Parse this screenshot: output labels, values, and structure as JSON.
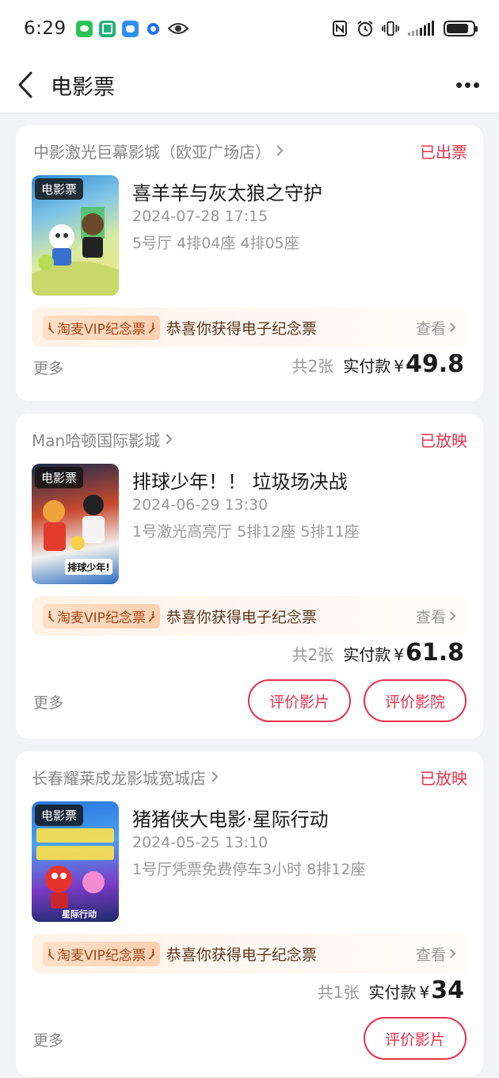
{
  "status_bar": {
    "time": "6:29",
    "battery_level": 0.85
  },
  "nav": {
    "title": "电影票"
  },
  "tickets": [
    {
      "cinema": "中影激光巨幕影城（欧亚广场店）",
      "status": "已出票",
      "poster_tag": "电影票",
      "movie_title": "喜羊羊与灰太狼之守护",
      "datetime": "2024-07-28 17:15",
      "seats": "5号厅 4排04座 4排05座",
      "vip_badge": "淘麦VIP纪念票",
      "vip_text": "恭喜你获得电子纪念票",
      "vip_link": "查看",
      "more": "更多",
      "count": "共2张",
      "paid_label": "实付款",
      "currency": "¥",
      "amount": "49.8",
      "actions": []
    },
    {
      "cinema": "Man哈顿国际影城",
      "status": "已放映",
      "poster_tag": "电影票",
      "movie_title": "排球少年！！ 垃圾场决战",
      "datetime": "2024-06-29 13:30",
      "seats": "1号激光高亮厅 5排12座 5排11座",
      "vip_badge": "淘麦VIP纪念票",
      "vip_text": "恭喜你获得电子纪念票",
      "vip_link": "查看",
      "more": "更多",
      "count": "共2张",
      "paid_label": "实付款",
      "currency": "¥",
      "amount": "61.8",
      "actions": [
        "评价影片",
        "评价影院"
      ]
    },
    {
      "cinema": "长春耀莱成龙影城宽城店",
      "status": "已放映",
      "poster_tag": "电影票",
      "movie_title": "猪猪侠大电影·星际行动",
      "datetime": "2024-05-25 13:10",
      "seats": "1号厅凭票免费停车3小时 8排12座",
      "vip_badge": "淘麦VIP纪念票",
      "vip_text": "恭喜你获得电子纪念票",
      "vip_link": "查看",
      "more": "更多",
      "count": "共1张",
      "paid_label": "实付款",
      "currency": "¥",
      "amount": "34",
      "actions": [
        "评价影片"
      ]
    }
  ],
  "colors": {
    "accent": "#e8304a",
    "background": "#f2f3f5",
    "secondary_text": "#999999"
  }
}
